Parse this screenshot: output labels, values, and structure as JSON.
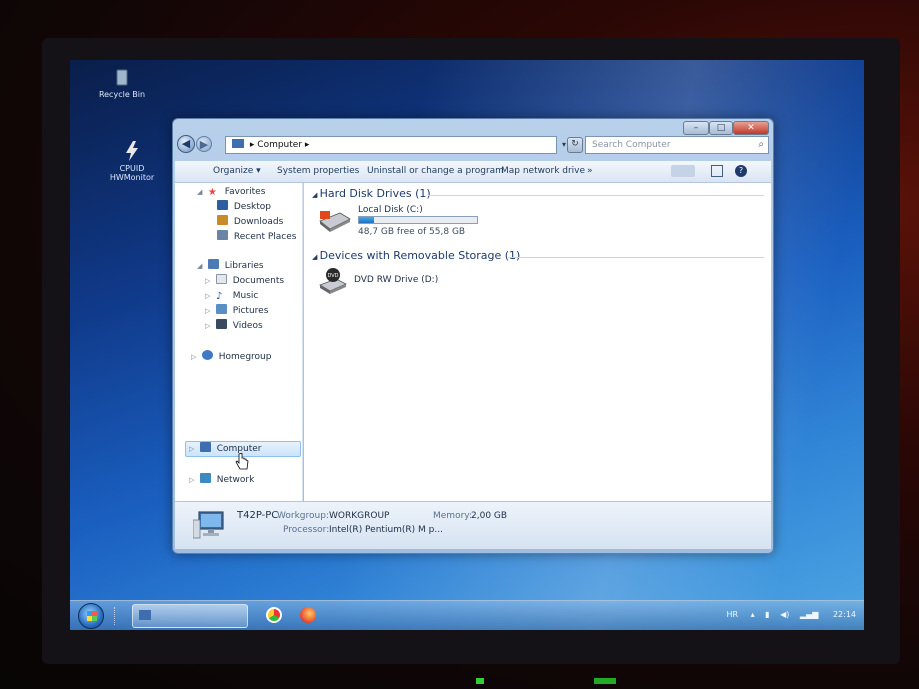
{
  "desktop": {
    "recycle_bin_label": "Recycle Bin",
    "cpuid_label_1": "CPUID",
    "cpuid_label_2": "HWMonitor"
  },
  "window": {
    "title_controls": {
      "minimize": "–",
      "maximize": "□",
      "close": "✕"
    },
    "back_icon": "back-arrow-icon",
    "forward_icon": "forward-arrow-icon",
    "address": {
      "breadcrumb": "Computer",
      "separator": "▸",
      "icon": "computer-icon"
    },
    "search": {
      "placeholder": "Search Computer",
      "icon": "magnifier-icon"
    },
    "toolbar": {
      "organize": "Organize ▾",
      "system_properties": "System properties",
      "uninstall": "Uninstall or change a program",
      "map_network": "Map network drive",
      "more": "»"
    },
    "nav": {
      "favorites": "Favorites",
      "desktop": "Desktop",
      "downloads": "Downloads",
      "recent_places": "Recent Places",
      "libraries": "Libraries",
      "documents": "Documents",
      "music": "Music",
      "pictures": "Pictures",
      "videos": "Videos",
      "homegroup": "Homegroup",
      "computer": "Computer",
      "network": "Network"
    },
    "content": {
      "group_hdd": "Hard Disk Drives (1)",
      "group_removable": "Devices with Removable Storage (1)",
      "local_disk": {
        "label": "Local Disk (C:)",
        "free_text": "48,7 GB free of 55,8 GB",
        "used_fraction": 0.13
      },
      "dvd": {
        "label": "DVD RW Drive (D:)",
        "badge": "DVD"
      }
    },
    "details": {
      "pc_name": "T42P-PC",
      "workgroup_label": "Workgroup:",
      "workgroup_value": "WORKGROUP",
      "memory_label": "Memory:",
      "memory_value": "2,00 GB",
      "processor_label": "Processor:",
      "processor_value": "Intel(R) Pentium(R) M p..."
    }
  },
  "taskbar": {
    "tray_lang": "HR",
    "clock": "22:14"
  },
  "colors": {
    "accent": "#1f6fc0",
    "wallpaper": "#1a5fc0"
  }
}
